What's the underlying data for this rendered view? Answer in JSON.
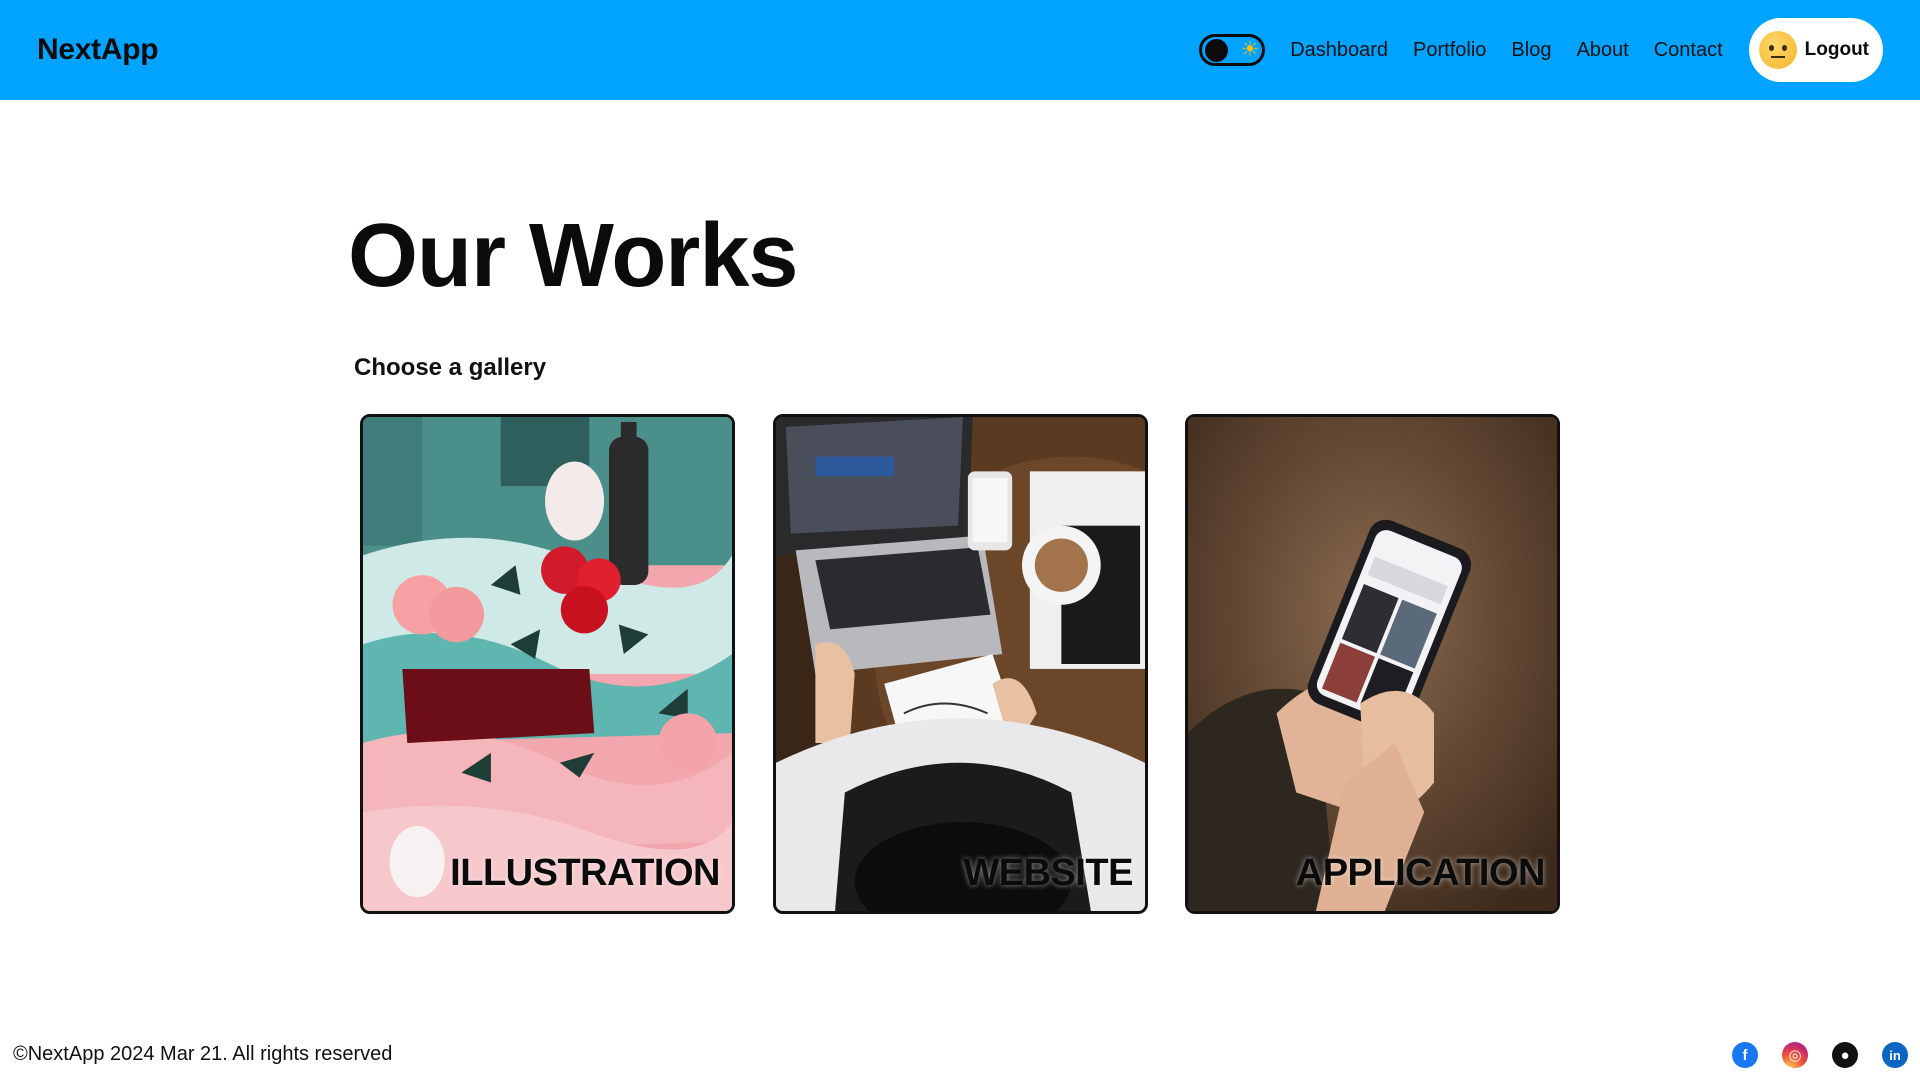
{
  "navbar": {
    "logo": "NextApp",
    "theme_toggle": {
      "sun_icon": "☀"
    },
    "links": [
      "Dashboard",
      "Portfolio",
      "Blog",
      "About",
      "Contact"
    ],
    "logout_label": "Logout",
    "background_color": "#00a3ff"
  },
  "main": {
    "title": "Our Works",
    "subtitle": "Choose a gallery",
    "galleries": [
      {
        "label": "ILLUSTRATION",
        "image": "illustration-painting"
      },
      {
        "label": "WEBSITE",
        "image": "laptop-desk-photo"
      },
      {
        "label": "APPLICATION",
        "image": "smartphone-hand-photo"
      }
    ]
  },
  "footer": {
    "copyright": "©NextApp 2024 Mar 21. All rights reserved",
    "socials": [
      {
        "name": "facebook",
        "glyph": "f"
      },
      {
        "name": "instagram",
        "glyph": "◎"
      },
      {
        "name": "github",
        "glyph": "●"
      },
      {
        "name": "linkedin",
        "glyph": "in"
      }
    ]
  }
}
